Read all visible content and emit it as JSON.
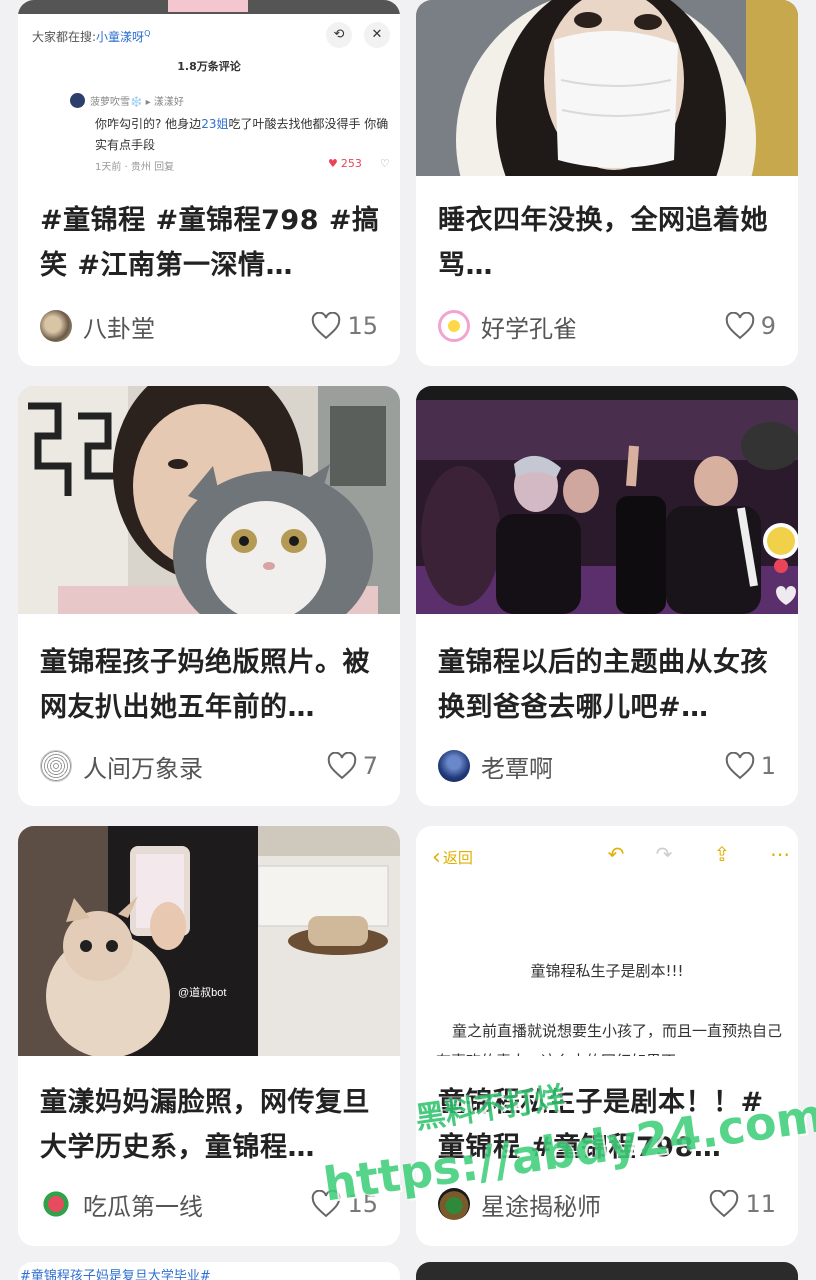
{
  "colors": {
    "background": "#f1f1f3",
    "card": "#ffffff",
    "title": "#222222",
    "watermark": "#3fcf7a",
    "accent_blue": "#2f6fd1",
    "like_red": "#e8445a"
  },
  "cards": [
    {
      "title": "#童锦程 #童锦程798 #搞笑 #江南第一深情…",
      "author": "八卦堂",
      "likes": "15",
      "thumb": {
        "search_prefix": "大家都在搜:",
        "search_term": "小童漾呀",
        "comment_count": "1.8万条评论",
        "commenter": "菠萝吹雪❄️",
        "reply_to": "▸ 漾漾好",
        "comment_a": "你咋勾引的? 他身边",
        "comment_link": "23姐",
        "comment_b": "吃了叶酸去找他都没得手 你确实有点手段",
        "meta": "1天前 · 贵州    回复",
        "comment_likes": "253"
      }
    },
    {
      "title": "睡衣四年没换，全网追着她骂…",
      "author": "好学孔雀",
      "likes": "9"
    },
    {
      "title": "童锦程孩子妈绝版照片。被网友扒出她五年前的…",
      "author": "人间万象录",
      "likes": "7"
    },
    {
      "title": "童锦程以后的主题曲从女孩换到爸爸去哪儿吧#…",
      "author": "老覃啊",
      "likes": "1"
    },
    {
      "title": "童漾妈妈漏脸照，网传复旦大学历史系，童锦程…",
      "author": "吃瓜第一线",
      "likes": "15",
      "thumb_watermark": "@道叔bot"
    },
    {
      "title": "童锦程私生子是剧本！！#童锦程 #童锦程798…",
      "author": "星途揭秘师",
      "likes": "11",
      "thumb": {
        "back_label": "返回",
        "note_title": "童锦程私生子是剧本!!!",
        "note_body": "童之前直播就说想要生小孩了，而且一直预热自己有喜欢的素人，这么大的网红如果不"
      }
    }
  ],
  "partial_next": {
    "left_caption": "#童锦程孩子妈是复旦大学毕业#"
  },
  "watermark": {
    "line1": "黑料不打烊",
    "line2": "https://abdy24.com"
  }
}
